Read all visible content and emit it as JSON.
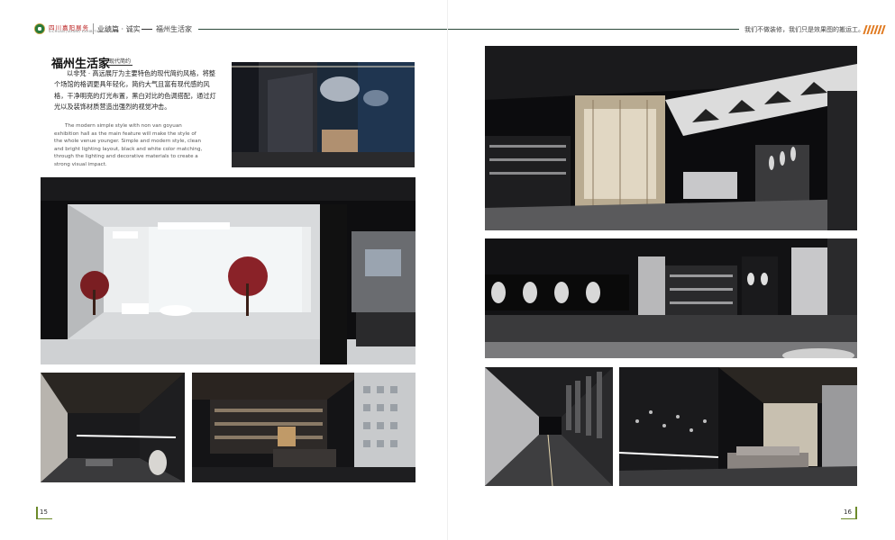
{
  "header": {
    "brand": "四川嘉阳展务",
    "brand_sub": "SICHUAN JIAYANG EXHIBITION SERVICE",
    "breadcrumb_section": "业绩篇 · 诚实",
    "breadcrumb_page": "福州生活家",
    "slogan": "我们不做装修，我们只是效果图的搬运工。"
  },
  "article": {
    "title": "福州生活家",
    "style_tag": "现代简约",
    "body_cn": "以非梵 · 高远展厅为主要特色的现代简约风格，将整个场馆的格调更具年轻化，简约大气且富有现代感的风格，干净明亮的灯光布置，黑白对比的色调搭配，通过灯光以及装饰材质营造出强烈的视觉冲击。",
    "body_en": "The modern simple style with non van goyuan exhibition hall as the main feature will make the style of the whole venue younger. Simple and modern style, clean and bright lighting layout, black and white color matching, through the lighting and decorative materials to create a strong visual impact."
  },
  "page_numbers": {
    "left": "15",
    "right": "16"
  },
  "colors": {
    "accent_green": "#2d4a3a",
    "accent_orange": "#e07a20",
    "page_bar": "#6c8a2a"
  }
}
